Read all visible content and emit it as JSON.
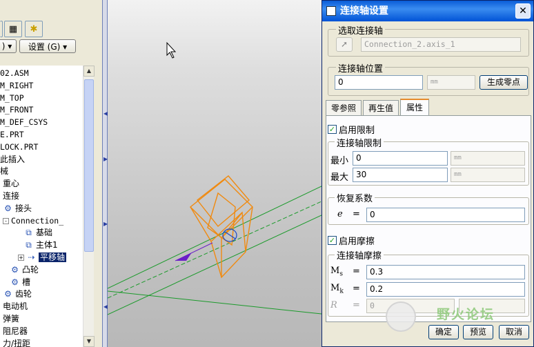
{
  "toolbar": {
    "btn1_icon": "▦",
    "btn2_icon": "✱",
    "btn3_icon": "⚒",
    "combo_left": ") ▾",
    "combo_settings": "设置 (G) ▾"
  },
  "tree": {
    "items": [
      {
        "label": "02.ASM",
        "style": "mono"
      },
      {
        "label": "M_RIGHT",
        "style": "mono"
      },
      {
        "label": "M_TOP",
        "style": "mono"
      },
      {
        "label": "M_FRONT",
        "style": "mono"
      },
      {
        "label": "M_DEF_CSYS",
        "style": "mono"
      },
      {
        "label": "E.PRT",
        "style": "mono"
      },
      {
        "label": "LOCK.PRT",
        "style": "mono"
      },
      {
        "label": "此插入",
        "style": ""
      },
      {
        "label": "械",
        "style": ""
      },
      {
        "label": "重心",
        "style": ""
      },
      {
        "label": "连接",
        "style": ""
      },
      {
        "label": "接头",
        "style": ""
      },
      {
        "label": "Connection_",
        "style": "mono"
      },
      {
        "label": "基础",
        "style": ""
      },
      {
        "label": "主体1",
        "style": ""
      },
      {
        "label": "平移轴",
        "style": ""
      },
      {
        "label": "凸轮",
        "style": ""
      },
      {
        "label": "槽",
        "style": ""
      },
      {
        "label": "齿轮",
        "style": ""
      },
      {
        "label": "电动机",
        "style": ""
      },
      {
        "label": "弹簧",
        "style": ""
      },
      {
        "label": "阻尼器",
        "style": ""
      },
      {
        "label": "力/扭距",
        "style": ""
      }
    ]
  },
  "dialog": {
    "title": "连接轴设置",
    "close_label": "✕",
    "select_axis": {
      "group_title": "选取连接轴",
      "value": "Connection_2.axis_1"
    },
    "position": {
      "group_title": "连接轴位置",
      "value": "0",
      "unit": "mm",
      "button": "生成零点"
    },
    "tabs": [
      "零参照",
      "再生值",
      "属性"
    ],
    "active_tab": "属性",
    "limits": {
      "checkbox_label": "启用限制",
      "checked": true,
      "group_title": "连接轴限制",
      "min_label": "最小",
      "min_value": "0",
      "max_label": "最大",
      "max_value": "30",
      "unit": "mm"
    },
    "restitution": {
      "group_title": "恢复系数",
      "symbol": "e",
      "eq": "=",
      "value": "0"
    },
    "friction": {
      "checkbox_label": "启用摩擦",
      "checked": true,
      "group_title": "连接轴摩擦",
      "mus_symbol": "M",
      "mus_sub": "s",
      "mus_value": "0.3",
      "muk_symbol": "M",
      "muk_sub": "k",
      "muk_value": "0.2",
      "r_symbol": "R",
      "r_value": "0",
      "eq": "="
    },
    "buttons": {
      "ok": "确定",
      "preview": "预览",
      "cancel": "取消"
    }
  },
  "watermark": "野火论坛",
  "colors": {
    "tree_selection": "#0a246a",
    "wire_orange": "#f08a10",
    "axis_green": "#1a9a2a",
    "datum_purple": "#6a1fc8",
    "title_blue": "#0a5cd8"
  }
}
